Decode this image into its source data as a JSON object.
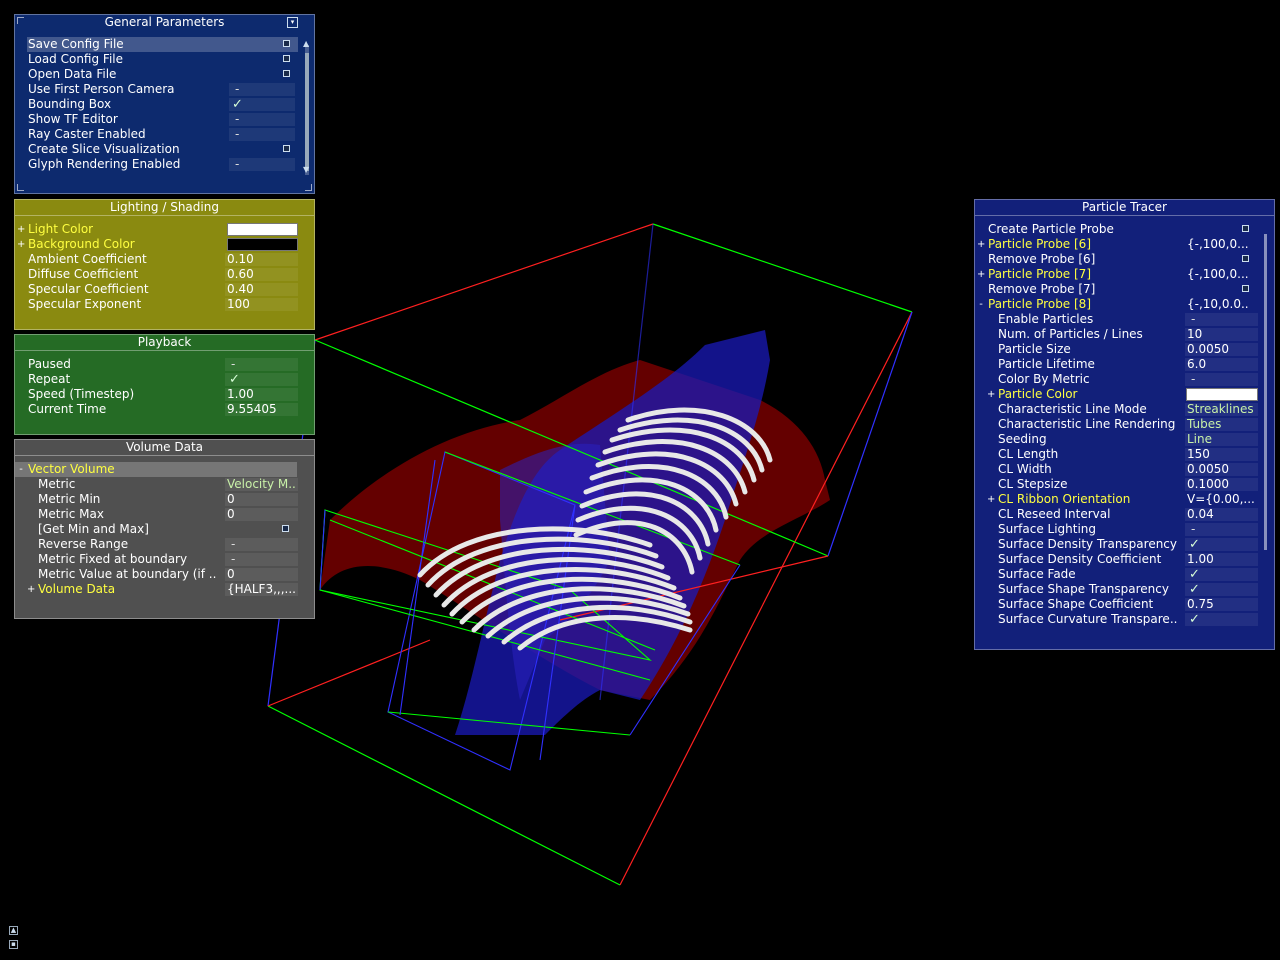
{
  "general": {
    "title": "General Parameters",
    "items": [
      {
        "label": "Save Config File",
        "type": "button"
      },
      {
        "label": "Load Config File",
        "type": "button"
      },
      {
        "label": "Open Data File",
        "type": "button"
      },
      {
        "label": "Use First Person Camera",
        "type": "toggle",
        "value": "-"
      },
      {
        "label": "Bounding Box",
        "type": "toggle",
        "value": "✓"
      },
      {
        "label": "Show TF Editor",
        "type": "toggle",
        "value": "-"
      },
      {
        "label": "Ray Caster Enabled",
        "type": "toggle",
        "value": "-"
      },
      {
        "label": "Create Slice Visualization",
        "type": "button"
      },
      {
        "label": "Glyph Rendering Enabled",
        "type": "toggle",
        "value": "-"
      }
    ]
  },
  "lighting": {
    "title": "Lighting / Shading",
    "light_color_label": "Light Color",
    "light_color": "#ffffff",
    "background_color_label": "Background Color",
    "background_color": "#000000",
    "ambient_label": "Ambient Coefficient",
    "ambient_value": "0.10",
    "diffuse_label": "Diffuse Coefficient",
    "diffuse_value": "0.60",
    "specular_label": "Specular Coefficient",
    "specular_value": "0.40",
    "exponent_label": "Specular Exponent",
    "exponent_value": "100"
  },
  "playback": {
    "title": "Playback",
    "paused_label": "Paused",
    "paused_value": "-",
    "repeat_label": "Repeat",
    "repeat_value": "✓",
    "speed_label": "Speed (Timestep)",
    "speed_value": "1.00",
    "time_label": "Current Time",
    "time_value": "9.55405"
  },
  "volume": {
    "title": "Volume Data",
    "vector_volume_label": "Vector Volume",
    "metric_label": "Metric",
    "metric_value": "Velocity M..",
    "metric_min_label": "Metric Min",
    "metric_min_value": "0",
    "metric_max_label": "Metric Max",
    "metric_max_value": "0",
    "get_minmax_label": "[Get Min and Max]",
    "reverse_label": "Reverse Range",
    "reverse_value": "-",
    "fixed_label": "Metric Fixed at boundary",
    "fixed_value": "-",
    "boundary_label": "Metric Value at boundary (if ..",
    "boundary_value": "0",
    "volume_data_label": "Volume Data",
    "volume_data_value": "{HALF3,,,..."
  },
  "tracer": {
    "title": "Particle Tracer",
    "rows": [
      {
        "label": "Create Particle Probe",
        "type": "button",
        "indent": 0
      },
      {
        "label": "Particle Probe [6]",
        "type": "group",
        "exp": "+",
        "value": "{-,100,0...",
        "indent": 0
      },
      {
        "label": "Remove Probe [6]",
        "type": "button",
        "indent": 0
      },
      {
        "label": "Particle Probe [7]",
        "type": "group",
        "exp": "+",
        "value": "{-,100,0...",
        "indent": 0
      },
      {
        "label": "Remove Probe [7]",
        "type": "button",
        "indent": 0
      },
      {
        "label": "Particle Probe [8]",
        "type": "group",
        "exp": "-",
        "value": "{-,10,0.0..",
        "indent": 0
      },
      {
        "label": "Enable Particles",
        "type": "value",
        "value": "-",
        "indent": 1
      },
      {
        "label": "Num. of Particles / Lines",
        "type": "value",
        "value": "10",
        "indent": 1
      },
      {
        "label": "Particle Size",
        "type": "value",
        "value": "0.0050",
        "indent": 1
      },
      {
        "label": "Particle Lifetime",
        "type": "value",
        "value": "6.0",
        "indent": 1
      },
      {
        "label": "Color By Metric",
        "type": "value",
        "value": "-",
        "indent": 1
      },
      {
        "label": "Particle Color",
        "type": "color",
        "exp": "+",
        "value": "#ffffff",
        "indent": 1
      },
      {
        "label": "Characteristic Line Mode",
        "type": "enum",
        "value": "Streaklines",
        "indent": 1
      },
      {
        "label": "Characteristic Line Rendering",
        "type": "enum",
        "value": "Tubes",
        "indent": 1
      },
      {
        "label": "Seeding",
        "type": "enum",
        "value": "Line",
        "indent": 1
      },
      {
        "label": "CL Length",
        "type": "value",
        "value": "150",
        "indent": 1
      },
      {
        "label": "CL Width",
        "type": "value",
        "value": "0.0050",
        "indent": 1
      },
      {
        "label": "CL Stepsize",
        "type": "value",
        "value": "0.1000",
        "indent": 1
      },
      {
        "label": "CL Ribbon Orientation",
        "type": "group",
        "exp": "+",
        "value": "V={0.00,...",
        "indent": 1
      },
      {
        "label": "CL Reseed Interval",
        "type": "value",
        "value": "0.04",
        "indent": 1
      },
      {
        "label": "Surface Lighting",
        "type": "value",
        "value": "-",
        "indent": 1
      },
      {
        "label": "Surface Density Transparency",
        "type": "value",
        "value": "✓",
        "indent": 1
      },
      {
        "label": "Surface Density Coefficient",
        "type": "value",
        "value": "1.00",
        "indent": 1
      },
      {
        "label": "Surface Fade",
        "type": "value",
        "value": "✓",
        "indent": 1
      },
      {
        "label": "Surface Shape Transparency",
        "type": "value",
        "value": "✓",
        "indent": 1
      },
      {
        "label": "Surface Shape Coefficient",
        "type": "value",
        "value": "0.75",
        "indent": 1
      },
      {
        "label": "Surface Curvature Transpare..",
        "type": "value",
        "value": "✓",
        "indent": 1
      }
    ]
  },
  "colors": {
    "general_bg": "#0d2a6e",
    "lighting_bg": "#8a8a10",
    "playback_bg": "#256b25",
    "volume_bg": "#505050",
    "tracer_bg": "#12207a"
  },
  "bottom_icons": [
    "up-arrow-icon",
    "save-icon"
  ]
}
